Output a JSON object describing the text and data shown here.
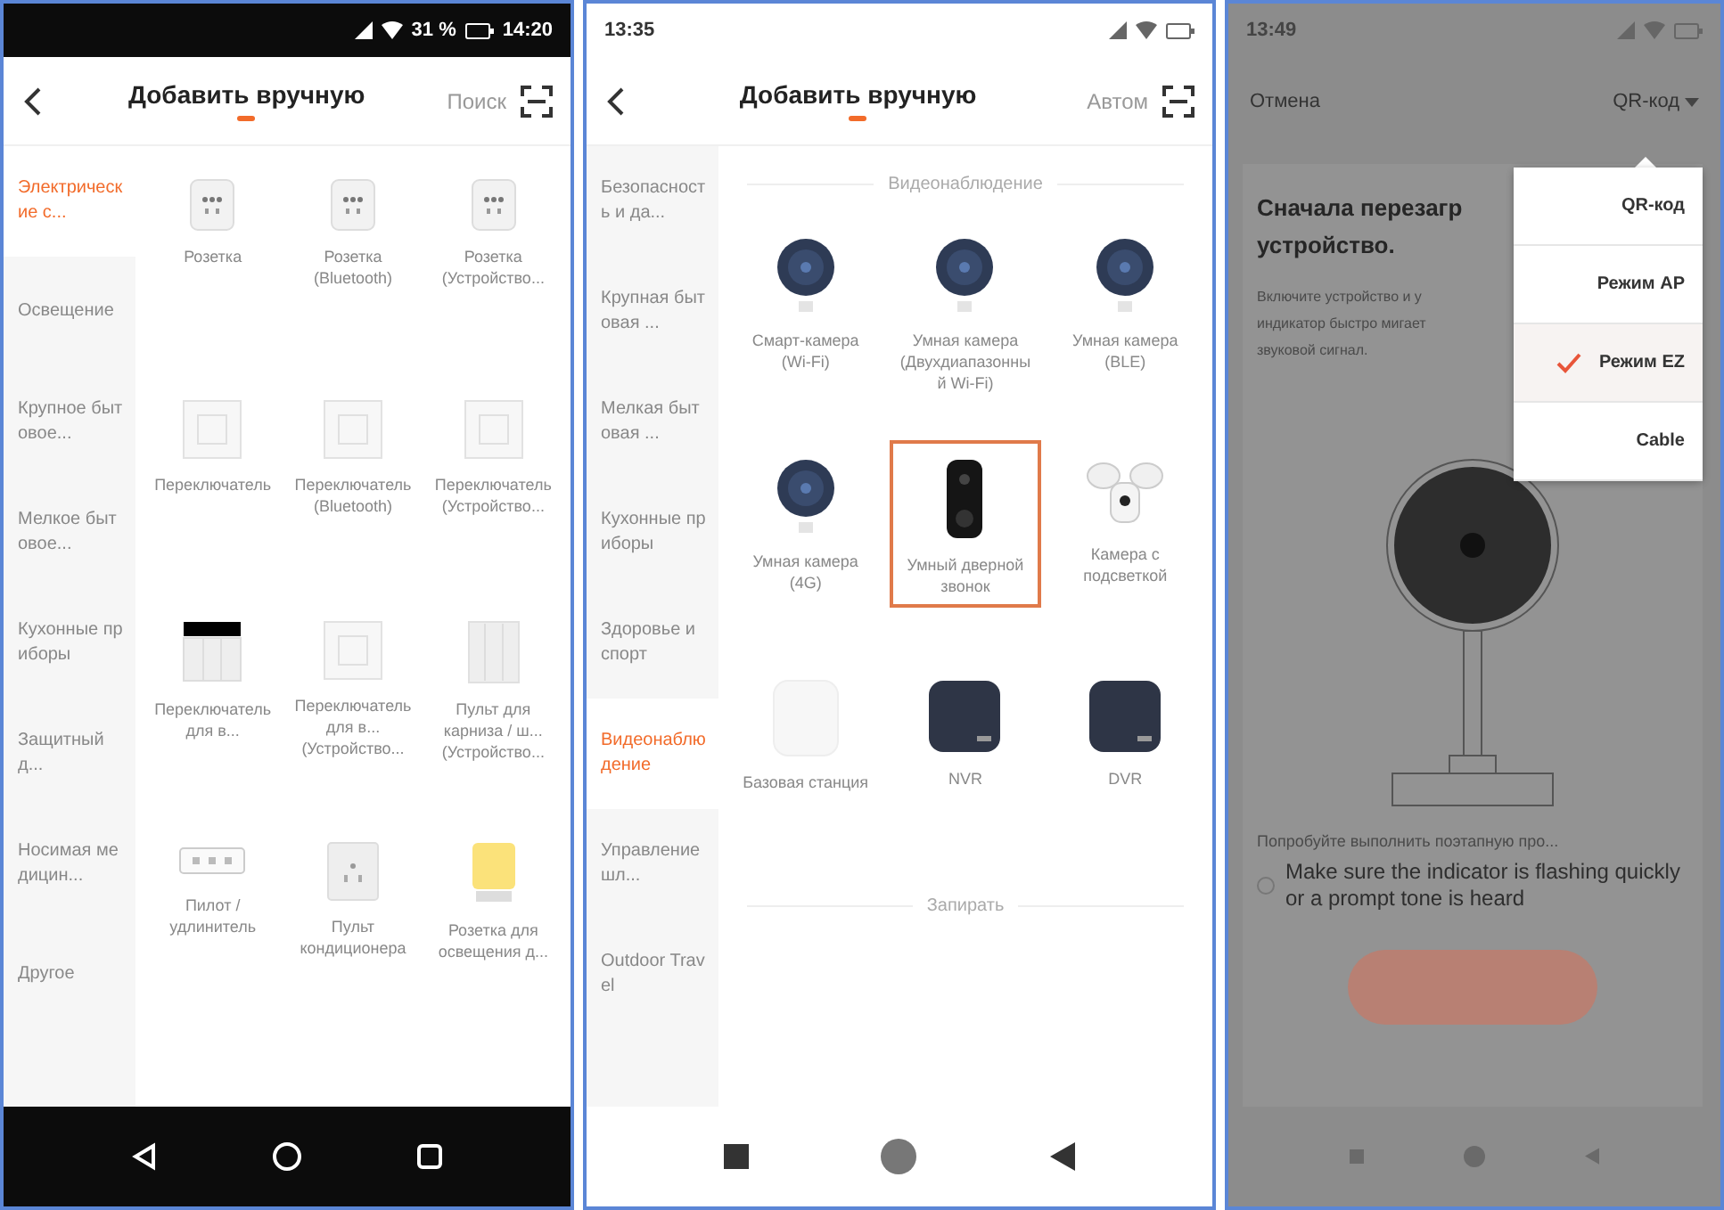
{
  "panels": [
    {
      "kind": "catalog",
      "status": {
        "dark": true,
        "time": "14:20",
        "battery": "31 %"
      },
      "header": {
        "title": "Добавить вручную",
        "action": "Поиск"
      },
      "sidebar": [
        {
          "label": "Электрические с...",
          "selected": true
        },
        {
          "label": "Освещение",
          "selected": false
        },
        {
          "label": "Крупное бытовое...",
          "selected": false
        },
        {
          "label": "Мелкое бытовое...",
          "selected": false
        },
        {
          "label": "Кухонные приборы",
          "selected": false
        },
        {
          "label": "Защитный д...",
          "selected": false
        },
        {
          "label": "Носимая медицин...",
          "selected": false
        },
        {
          "label": "Другое",
          "selected": false
        }
      ],
      "sections": [
        {
          "items": [
            {
              "label": "Розетка",
              "kind": "socket",
              "highlighted": false
            },
            {
              "label": "Розетка (Bluetooth)",
              "kind": "socket",
              "highlighted": false
            },
            {
              "label": "Розетка (Устройство...",
              "kind": "socket",
              "highlighted": false
            },
            {
              "label": "Переключатель",
              "kind": "switch",
              "highlighted": false
            },
            {
              "label": "Переключатель (Bluetooth)",
              "kind": "switch",
              "highlighted": false
            },
            {
              "label": "Переключатель (Устройство...",
              "kind": "switch",
              "highlighted": false
            },
            {
              "label": "Переключатель для в...",
              "kind": "touch_switch",
              "highlighted": false
            },
            {
              "label": "Переключатель для в... (Устройство...",
              "kind": "switch",
              "highlighted": false
            },
            {
              "label": "Пульт для карниза / ш... (Устройство...",
              "kind": "panel",
              "highlighted": false
            },
            {
              "label": "Пилот / удлинитель",
              "kind": "power_strip",
              "highlighted": false
            },
            {
              "label": "Пульт кондиционера",
              "kind": "ac_remote",
              "highlighted": false
            },
            {
              "label": "Розетка для освещения д...",
              "kind": "lamp",
              "highlighted": false
            }
          ]
        }
      ]
    },
    {
      "kind": "catalog",
      "status": {
        "dark": false,
        "time": "13:35"
      },
      "header": {
        "title": "Добавить вручную",
        "action": "Автом"
      },
      "sidebar": [
        {
          "label": "Безопасность и да...",
          "selected": false
        },
        {
          "label": "Крупная бытовая ...",
          "selected": false
        },
        {
          "label": "Мелкая бытовая ...",
          "selected": false
        },
        {
          "label": "Кухонные приборы",
          "selected": false
        },
        {
          "label": "Здоровье и спорт",
          "selected": false
        },
        {
          "label": "Видеонаблюдение",
          "selected": true
        },
        {
          "label": "Управление шл...",
          "selected": false
        },
        {
          "label": "Outdoor Travel",
          "selected": false
        }
      ],
      "sections": [
        {
          "title": "Видеонаблюдение",
          "items": [
            {
              "label": "Смарт-камера (Wi-Fi)",
              "kind": "camera",
              "highlighted": false
            },
            {
              "label": "Умная камера (Двухдиапазонный Wi-Fi)",
              "kind": "camera",
              "highlighted": false
            },
            {
              "label": "Умная камера (BLE)",
              "kind": "camera",
              "highlighted": false
            },
            {
              "label": "Умная камера (4G)",
              "kind": "camera",
              "highlighted": false
            },
            {
              "label": "Умный дверной звонок",
              "kind": "doorbell",
              "highlighted": true
            },
            {
              "label": "Камера с подсветкой",
              "kind": "floodlight",
              "highlighted": false
            },
            {
              "label": "Базовая станция",
              "kind": "base",
              "highlighted": false
            },
            {
              "label": "NVR",
              "kind": "recorder",
              "highlighted": false
            },
            {
              "label": "DVR",
              "kind": "recorder",
              "highlighted": false
            }
          ]
        },
        {
          "title": "Запирать"
        }
      ]
    },
    {
      "kind": "setup",
      "status": {
        "dark": false,
        "time": "13:49"
      },
      "cancel": "Отмена",
      "mode": "QR-код",
      "heading": [
        "Сначала перезагр",
        "устройство."
      ],
      "body": [
        "Включите устройство и у",
        "индикатор быстро мигает",
        "звуковой сигнал."
      ],
      "menu": [
        {
          "label": "QR-код",
          "selected": false
        },
        {
          "label": "Режим AP",
          "selected": false
        },
        {
          "label": "Режим EZ",
          "selected": true
        },
        {
          "label": "Cable",
          "selected": false
        }
      ],
      "hint": "Попробуйте выполнить поэтапную про...",
      "confirm": {
        "text": "Make sure the indicator is flashing quickly or a prompt tone is heard",
        "checked": false
      }
    }
  ]
}
